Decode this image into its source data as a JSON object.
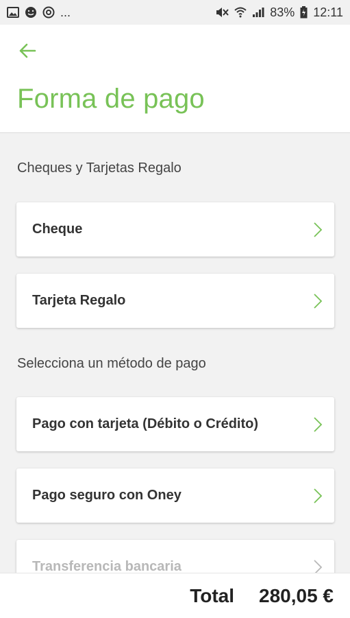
{
  "status_bar": {
    "left_icons": [
      "image-icon",
      "emoji-icon",
      "notification-icon"
    ],
    "ellipsis": "...",
    "right_icons": [
      "mute-icon",
      "wifi-icon",
      "signal-icon"
    ],
    "battery": "83%",
    "time": "12:11"
  },
  "header": {
    "back_icon": "arrow-left-icon",
    "title": "Forma de pago"
  },
  "sections": {
    "gift": {
      "title": "Cheques y Tarjetas Regalo",
      "items": [
        {
          "label": "Cheque"
        },
        {
          "label": "Tarjeta Regalo"
        }
      ]
    },
    "payment": {
      "title": "Selecciona un método de pago",
      "items": [
        {
          "label": "Pago con tarjeta (Débito o Crédito)"
        },
        {
          "label": "Pago seguro con Oney"
        },
        {
          "label": "Transferencia bancaria"
        }
      ]
    }
  },
  "footer": {
    "total_label": "Total",
    "total_value": "280,05 €"
  },
  "colors": {
    "accent": "#78c257",
    "background": "#f2f2f2",
    "card": "#ffffff",
    "text": "#333333"
  }
}
